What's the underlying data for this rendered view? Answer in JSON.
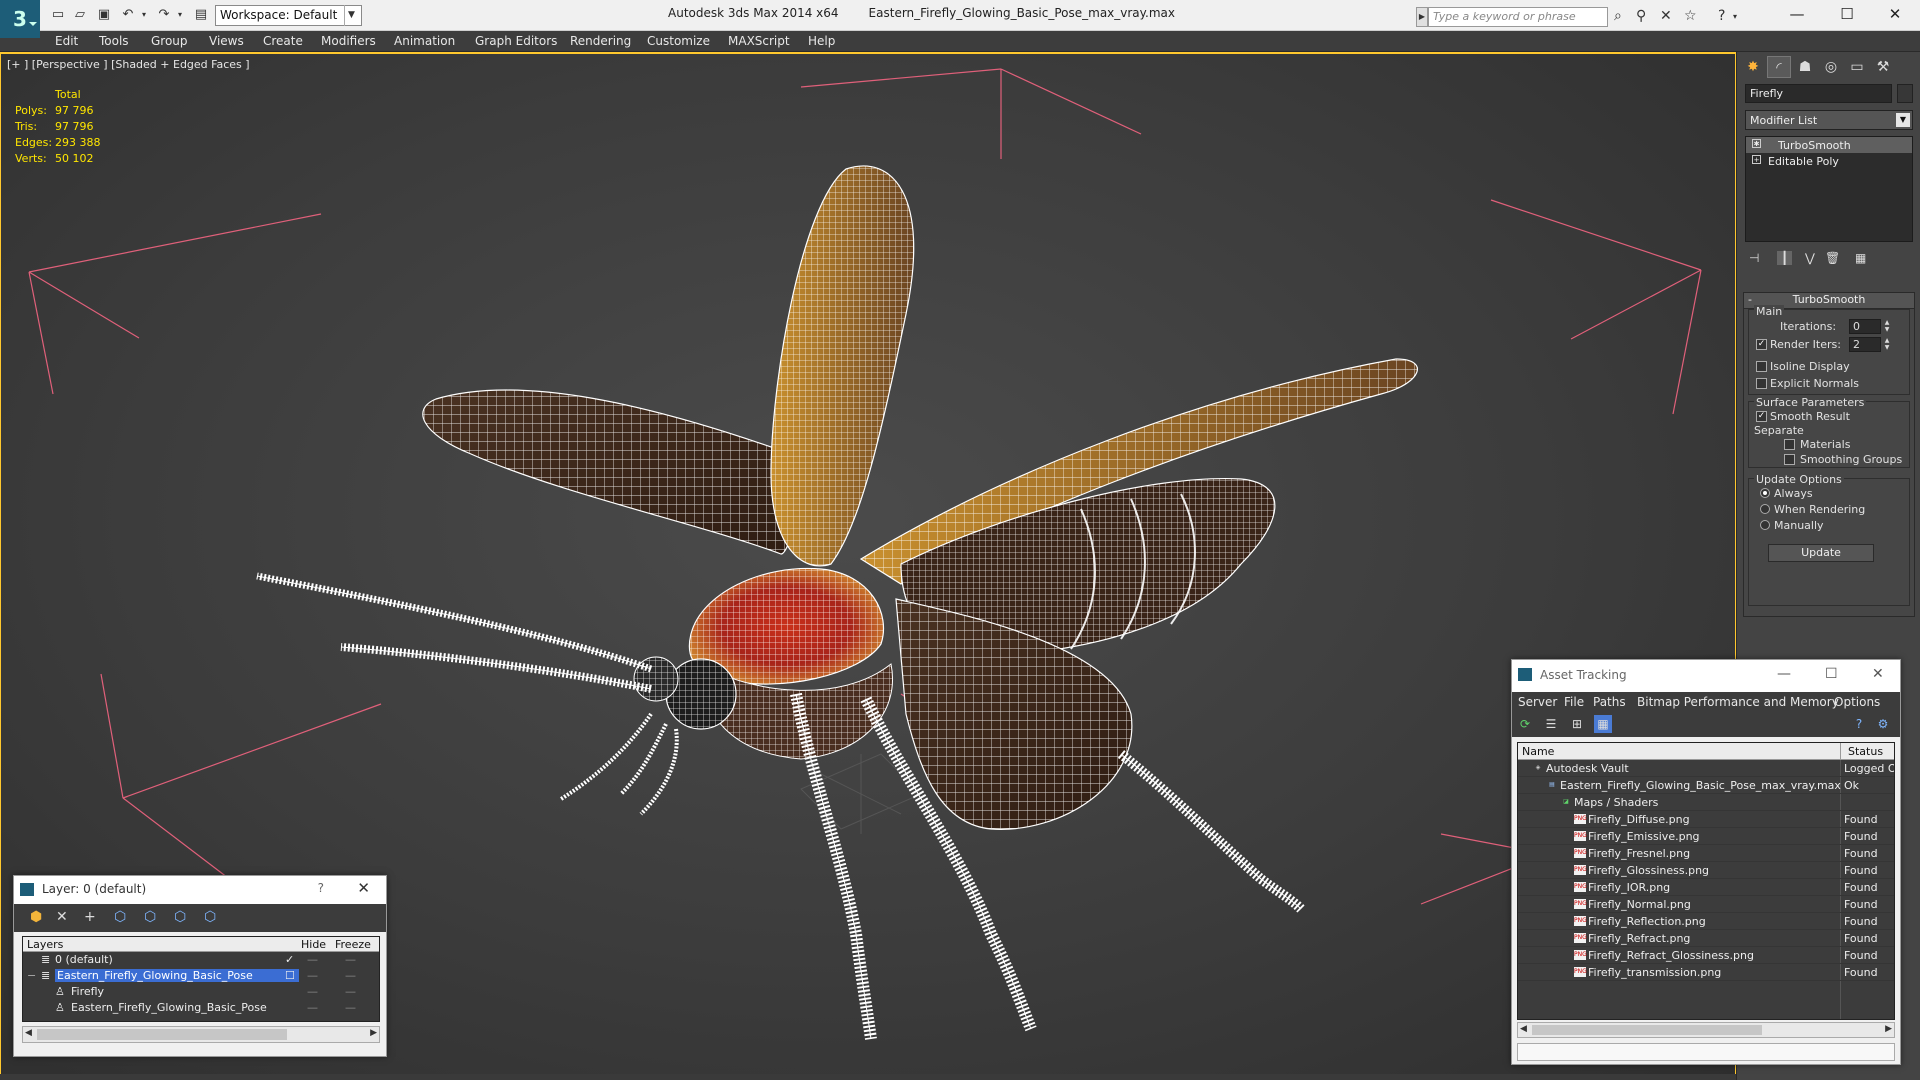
{
  "titlebar": {
    "workspace": "Workspace: Default",
    "app_name": "Autodesk 3ds Max  2014 x64",
    "file_name": "Eastern_Firefly_Glowing_Basic_Pose_max_vray.max",
    "search_placeholder": "Type a keyword or phrase"
  },
  "menubar": [
    "Edit",
    "Tools",
    "Group",
    "Views",
    "Create",
    "Modifiers",
    "Animation",
    "Graph Editors",
    "Rendering",
    "Customize",
    "MAXScript",
    "Help"
  ],
  "viewport": {
    "label": "[+ ] [Perspective ] [Shaded + Edged Faces ]",
    "stats": {
      "header": "Total",
      "rows": [
        {
          "k": "Polys:",
          "v": "97 796"
        },
        {
          "k": "Tris:",
          "v": "97 796"
        },
        {
          "k": "Edges:",
          "v": "293 388"
        },
        {
          "k": "Verts:",
          "v": "50 102"
        }
      ]
    },
    "accent": "#ffc82e"
  },
  "command_panel": {
    "object_name": "Firefly",
    "modifier_list": "Modifier List",
    "stack": [
      "TurboSmooth",
      "Editable Poly"
    ],
    "rollout_title": "TurboSmooth",
    "main_label": "Main",
    "iterations_label": "Iterations:",
    "iterations_value": "0",
    "render_iters_label": "Render Iters:",
    "render_iters_value": "2",
    "isoline_label": "Isoline Display",
    "explicit_normals_label": "Explicit Normals",
    "surface_params_label": "Surface Parameters",
    "smooth_result_label": "Smooth Result",
    "separate_label": "Separate",
    "materials_label": "Materials",
    "smoothing_groups_label": "Smoothing Groups",
    "update_options_label": "Update Options",
    "always_label": "Always",
    "when_rendering_label": "When Rendering",
    "manually_label": "Manually",
    "update_button": "Update"
  },
  "layer_dialog": {
    "title": "Layer: 0 (default)",
    "help": "?",
    "col_layers": "Layers",
    "col_hide": "Hide",
    "col_freeze": "Freeze",
    "rows": [
      {
        "name": "0 (default)",
        "indent": 0
      },
      {
        "name": "Eastern_Firefly_Glowing_Basic_Pose",
        "indent": 0
      },
      {
        "name": "Firefly",
        "indent": 1
      },
      {
        "name": "Eastern_Firefly_Glowing_Basic_Pose",
        "indent": 1
      }
    ]
  },
  "asset_dialog": {
    "title": "Asset Tracking",
    "menu": [
      "Server",
      "File",
      "Paths",
      "Bitmap Performance and Memory",
      "Options"
    ],
    "col_name": "Name",
    "col_status": "Status",
    "rows": [
      {
        "name": "Autodesk Vault",
        "status": "Logged O",
        "indent": 0,
        "icon": "vault"
      },
      {
        "name": "Eastern_Firefly_Glowing_Basic_Pose_max_vray.max",
        "status": "Ok",
        "indent": 1,
        "icon": "max"
      },
      {
        "name": "Maps / Shaders",
        "status": "",
        "indent": 2,
        "icon": "maps"
      },
      {
        "name": "Firefly_Diffuse.png",
        "status": "Found",
        "indent": 3,
        "icon": "png"
      },
      {
        "name": "Firefly_Emissive.png",
        "status": "Found",
        "indent": 3,
        "icon": "png"
      },
      {
        "name": "Firefly_Fresnel.png",
        "status": "Found",
        "indent": 3,
        "icon": "png"
      },
      {
        "name": "Firefly_Glossiness.png",
        "status": "Found",
        "indent": 3,
        "icon": "png"
      },
      {
        "name": "Firefly_IOR.png",
        "status": "Found",
        "indent": 3,
        "icon": "png"
      },
      {
        "name": "Firefly_Normal.png",
        "status": "Found",
        "indent": 3,
        "icon": "png"
      },
      {
        "name": "Firefly_Reflection.png",
        "status": "Found",
        "indent": 3,
        "icon": "png"
      },
      {
        "name": "Firefly_Refract.png",
        "status": "Found",
        "indent": 3,
        "icon": "png"
      },
      {
        "name": "Firefly_Refract_Glossiness.png",
        "status": "Found",
        "indent": 3,
        "icon": "png"
      },
      {
        "name": "Firefly_transmission.png",
        "status": "Found",
        "indent": 3,
        "icon": "png"
      }
    ]
  }
}
